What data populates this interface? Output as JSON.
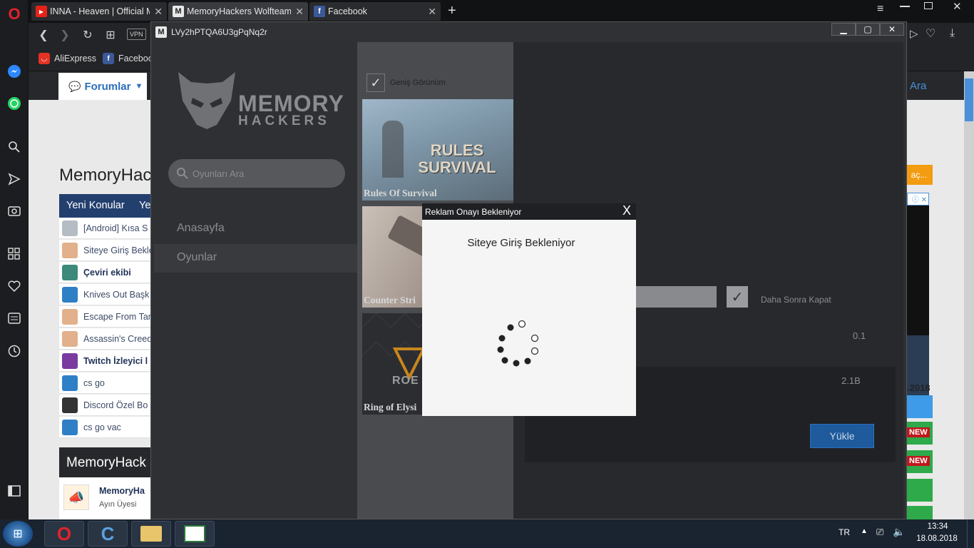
{
  "browser": {
    "tabs": [
      {
        "title": "INNA - Heaven | Official M",
        "favicon": "youtube-icon"
      },
      {
        "title": "MemoryHackers Wolfteam",
        "favicon": "memoryhackers-icon"
      },
      {
        "title": "Facebook",
        "favicon": "facebook-icon"
      }
    ],
    "new_tab": "+",
    "vpn": "VPN",
    "bookmarks": [
      {
        "label": "AliExpress"
      },
      {
        "label": "Faceboo"
      }
    ]
  },
  "website": {
    "nav_forum": "Forumlar",
    "nav_search": "Ara",
    "heading": "MemoryHack",
    "tabs": [
      "Yeni Konular",
      "Ye"
    ],
    "threads": [
      {
        "title": "[Android] Kısa S",
        "bold": false
      },
      {
        "title": "Siteye Giriş Bekle",
        "bold": false
      },
      {
        "title": "Çeviri ekibi",
        "bold": true
      },
      {
        "title": "Knives Out Başk",
        "bold": false
      },
      {
        "title": "Escape From Tar",
        "bold": false
      },
      {
        "title": "Assassin's Creed",
        "bold": false
      },
      {
        "title": "Twitch İzleyici l",
        "bold": true
      },
      {
        "title": "cs go",
        "bold": false
      },
      {
        "title": "Discord Özel Bo",
        "bold": false
      },
      {
        "title": "cs go vac",
        "bold": false
      }
    ],
    "section2_heading": "MemoryHack",
    "member_name": "MemoryHa",
    "member_role": "Ayın Üyesi",
    "right_button": "aç...",
    "date_partial": ".2018",
    "new_badge": "NEW"
  },
  "app": {
    "window_title": "LVy2hPTQA6U3gPqNq2r",
    "logo_line1": "MEMORY",
    "logo_line2": "HACKERS",
    "search_placeholder": "Oyunları Ara",
    "menu": [
      "Anasayfa",
      "Oyunlar"
    ],
    "wide_view_label": "Geniş Görünüm",
    "games": [
      {
        "name": "Rules Of Survival",
        "art": "RULES SURVIVAL"
      },
      {
        "name": "Counter Stri",
        "art": ""
      },
      {
        "name": "Ring of Elysi",
        "art": "ROE"
      }
    ],
    "close_later_label": "Daha Sonra Kapat",
    "version": "0.1",
    "size": "2.1B",
    "install_button": "Yükle"
  },
  "modal": {
    "header": "Reklam Onayı Bekleniyor",
    "close": "X",
    "message": "Siteye Giriş Bekleniyor"
  },
  "taskbar": {
    "language": "TR",
    "time": "13:34",
    "date": "18.08.2018"
  },
  "colors": {
    "accent_blue": "#1e5a9c",
    "app_bg": "#2e3034",
    "modal_bg": "#f5f5f5"
  }
}
